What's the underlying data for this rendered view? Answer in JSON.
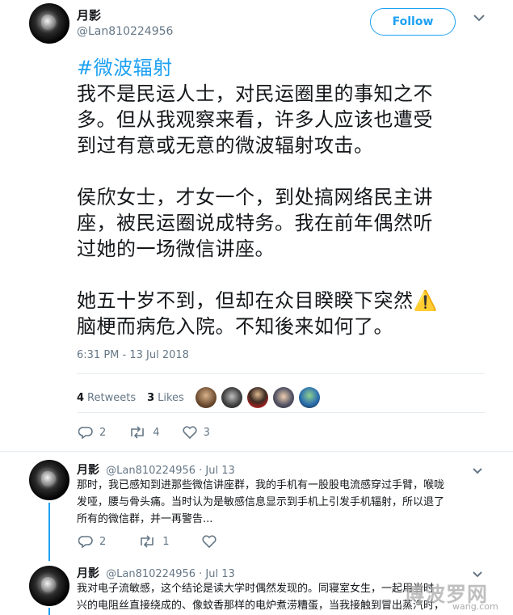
{
  "tweet": {
    "display_name": "月影",
    "handle": "@Lan810224956",
    "follow_label": "Follow",
    "hashtag": "#微波辐射",
    "paragraphs": [
      [
        "我不是民运人士，对民运圈里的事知之不",
        "多。但从我观察来看，许多人应该也遭受",
        "到过有意或无意的微波辐射攻击。"
      ],
      [
        "侯欣女士，才女一个，到处搞网络民主讲",
        "座，被民运圈说成特务。我在前年偶然听",
        "过她的一场微信讲座。"
      ],
      [
        "她五十岁不到，但却在众目睽睽下突然⚠️",
        "脑梗而病危入院。不知後来如何了。"
      ]
    ],
    "timestamp": "6:31 PM - 13 Jul 2018",
    "retweets_count": "4",
    "retweets_label": "Retweets",
    "likes_count": "3",
    "likes_label": "Likes",
    "reply_count": "2",
    "retweet_action_count": "4",
    "like_action_count": "3"
  },
  "replies": [
    {
      "display_name": "月影",
      "handle": "@Lan810224956",
      "date": "· Jul 13",
      "lines": [
        "那时，我已感知到进那些微信讲座群，我的手机有一股股电流感穿过手臂，喉咙",
        "发哑，腰与骨头痛。当时认为是敏感信息显示到手机上引发手机辐射，所以退了",
        "所有的微信群，并一再警告..."
      ],
      "reply_count": "2",
      "retweet_count": "1",
      "like_count": ""
    },
    {
      "display_name": "月影",
      "handle": "@Lan810224956",
      "date": "· Jul 13",
      "lines": [
        "我对电子流敏感，这个结论是读大学时偶然发现的。同寝室女生，一起用当时",
        "兴的电阻丝直接绕成的、像蚊香那样的电炉煮涝糟蛋，当我接触到冒出蒸汽时，"
      ]
    }
  ],
  "watermark": {
    "text": "博波罗网",
    "sub": "wang.com"
  },
  "colors": {
    "accent": "#1da1f2",
    "muted": "#657786",
    "text": "#14171a",
    "warning": "#f4b400"
  }
}
